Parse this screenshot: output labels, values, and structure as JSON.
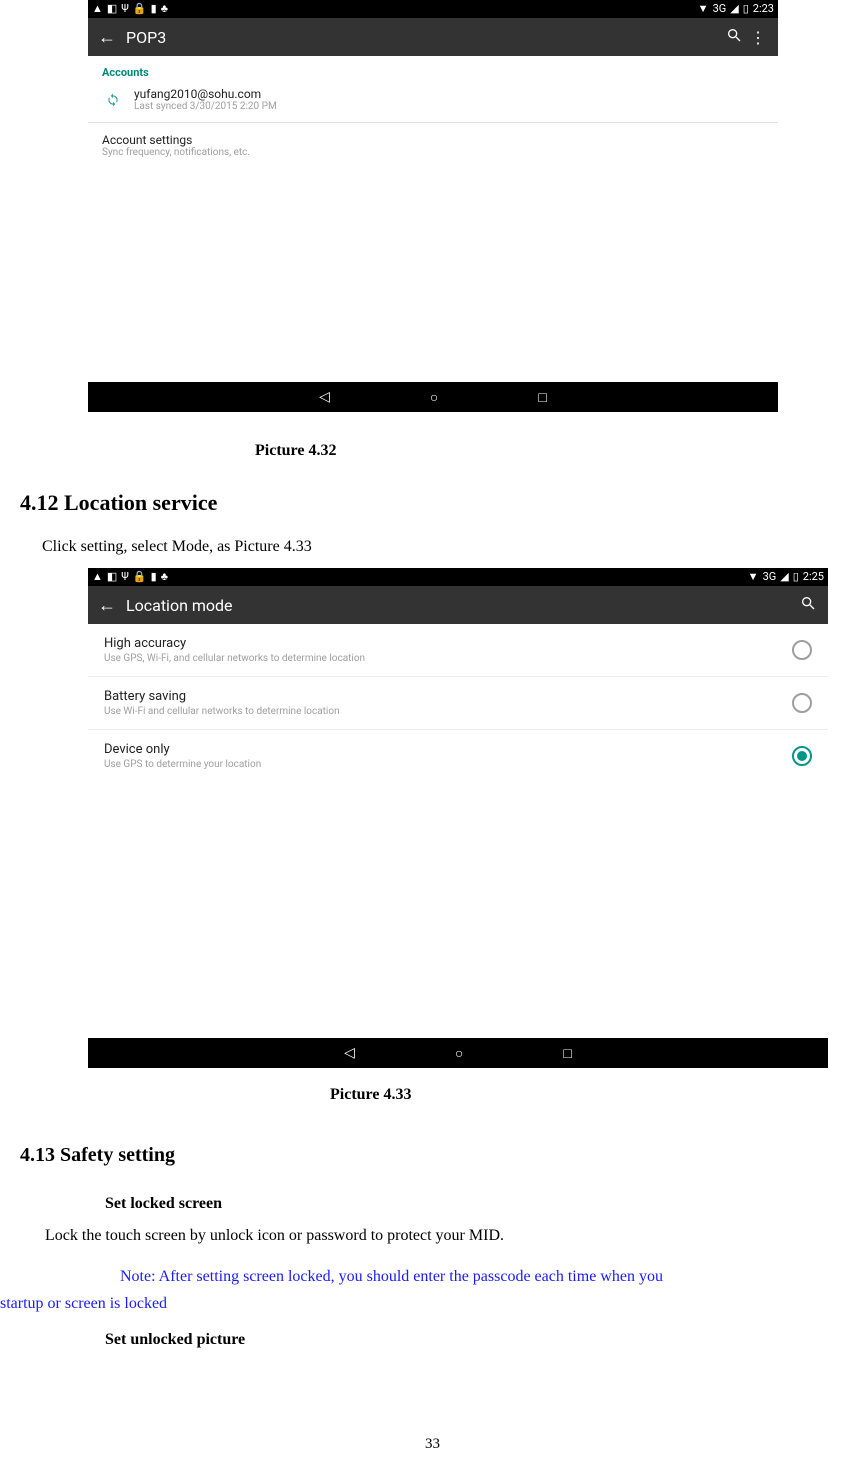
{
  "shot1": {
    "status": {
      "time": "2:23",
      "network": "3G"
    },
    "header": {
      "title": "POP3"
    },
    "accounts_label": "Accounts",
    "account": {
      "email": "yufang2010@sohu.com",
      "synced": "Last synced 3/30/2015 2:20 PM"
    },
    "account_settings": {
      "title": "Account settings",
      "sub": "Sync frequency, notifications, etc."
    }
  },
  "caption1": "Picture 4.32",
  "section_412_title": "4.12 Location service",
  "section_412_body": "Click setting, select Mode, as Picture 4.33",
  "shot2": {
    "status": {
      "time": "2:25",
      "network": "3G"
    },
    "header": {
      "title": "Location mode"
    },
    "options": [
      {
        "title": "High accuracy",
        "sub": "Use GPS, Wi-Fi, and cellular networks to determine location",
        "selected": "off"
      },
      {
        "title": "Battery saving",
        "sub": "Use Wi-Fi and cellular networks to determine location",
        "selected": "off"
      },
      {
        "title": "Device only",
        "sub": "Use GPS to determine your location",
        "selected": "on"
      }
    ]
  },
  "caption2": "Picture 4.33",
  "section_413_title": "4.13   Safety setting",
  "sub_set_locked": "Set locked screen",
  "body_lock": "Lock the touch screen by unlock icon or password to protect your MID.",
  "note_line1": "Note: After setting screen locked, you should enter the passcode each time when you",
  "note_line2": "startup or screen is locked",
  "sub_set_unlocked": "Set unlocked picture",
  "page_number": "33"
}
